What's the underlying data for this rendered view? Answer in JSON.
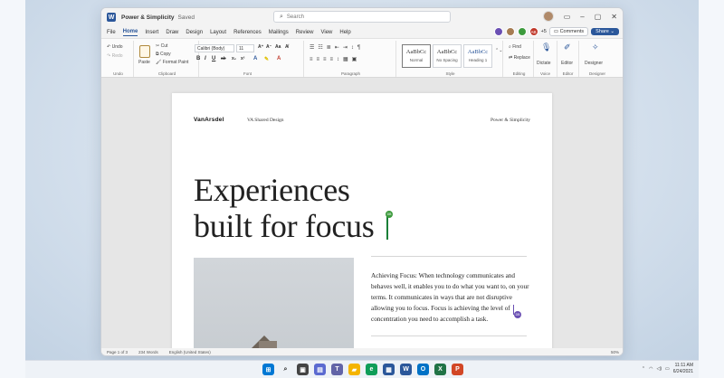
{
  "window": {
    "app_letter": "W",
    "doc_title": "Power & Simplicity",
    "save_state": "Saved",
    "search_placeholder": "Search"
  },
  "menu": {
    "items": [
      "File",
      "Home",
      "Insert",
      "Draw",
      "Design",
      "Layout",
      "References",
      "Mailings",
      "Review",
      "View",
      "Help"
    ],
    "active": "Home"
  },
  "collab": {
    "extra_count": "+5",
    "avatar_initials": "AB",
    "comments_label": "Comments",
    "share_label": "Share"
  },
  "ribbon": {
    "undo_label": "Undo",
    "redo_label": "Redo",
    "undo_group": "Undo",
    "paste_label": "Paste",
    "cut_label": "Cut",
    "copy_label": "Copy",
    "format_painter_label": "Format Paint",
    "clipboard_group": "Clipboard",
    "font_name": "Calibri (Body)",
    "font_size": "11",
    "font_group": "Font",
    "paragraph_group": "Paragraph",
    "styles": [
      {
        "sample": "AaBbCc",
        "name": "Normal"
      },
      {
        "sample": "AaBbCc",
        "name": "No Spacing"
      },
      {
        "sample": "AaBbCc",
        "name": "Heading 1"
      }
    ],
    "style_group": "Style",
    "find_label": "Find",
    "replace_label": "Replace",
    "editing_group": "Editing",
    "dictate_label": "Dictate",
    "voice_group": "Voice",
    "editor_label": "Editor",
    "editor_group": "Editor",
    "designer_label": "Designer",
    "designer_group": "Designer"
  },
  "document": {
    "header_logo": "VanArsdel",
    "header_center": "VA Shared Design",
    "header_right": "Power & Simplicity",
    "headline_line1": "Experiences",
    "headline_line2": "built for focus",
    "cursor_tag": "DB",
    "edit_tag": "DB",
    "body": "Achieving Focus: When technology communicates and behaves well, it enables you to do what you want to, on your terms. It communicates in ways that are not disruptive allowing you to focus. Focus is achieving the level of concentration you need to accomplish a task."
  },
  "status": {
    "page": "Page 1 of 3",
    "words": "234 Words",
    "language": "English (United States)",
    "zoom": "50%"
  },
  "taskbar": {
    "time": "11:11 AM",
    "date": "6/24/2021"
  },
  "colors": {
    "word_blue": "#2b579a",
    "cursor_green": "#3c9a3c",
    "collab_purple": "#6a4fb3"
  }
}
